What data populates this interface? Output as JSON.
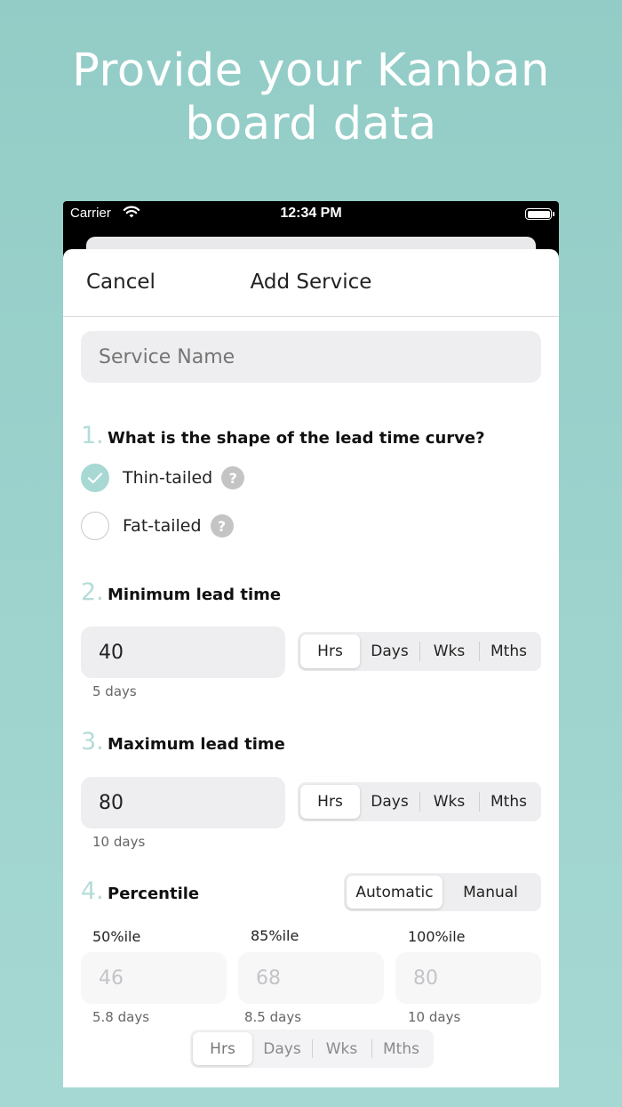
{
  "headline": {
    "line1": "Provide your Kanban",
    "line2": "board data"
  },
  "status_bar": {
    "carrier": "Carrier",
    "time": "12:34 PM"
  },
  "nav": {
    "cancel_label": "Cancel",
    "title": "Add Service"
  },
  "service_name": {
    "placeholder": "Service Name",
    "value": ""
  },
  "section1": {
    "number": "1.",
    "title": "What is the shape of the lead time curve?",
    "options": [
      {
        "label": "Thin-tailed",
        "checked": true
      },
      {
        "label": "Fat-tailed",
        "checked": false
      }
    ],
    "help_glyph": "?"
  },
  "section2": {
    "number": "2.",
    "title": "Minimum lead time",
    "value": "40",
    "caption": "5 days",
    "units": [
      "Hrs",
      "Days",
      "Wks",
      "Mths"
    ],
    "selected_unit": "Hrs"
  },
  "section3": {
    "number": "3.",
    "title": "Maximum lead time",
    "value": "80",
    "caption": "10 days",
    "units": [
      "Hrs",
      "Days",
      "Wks",
      "Mths"
    ],
    "selected_unit": "Hrs"
  },
  "section4": {
    "number": "4.",
    "title": "Percentile",
    "modes": [
      "Automatic",
      "Manual"
    ],
    "selected_mode": "Automatic",
    "percentiles": [
      {
        "label": "50%ile",
        "value": "46",
        "caption": "5.8 days"
      },
      {
        "label": "85%ile",
        "value": "68",
        "caption": "8.5 days"
      },
      {
        "label": "100%ile",
        "value": "80",
        "caption": "10 days"
      }
    ],
    "units": [
      "Hrs",
      "Days",
      "Wks",
      "Mths"
    ],
    "selected_unit": "Hrs"
  },
  "colors": {
    "background": "#93ccc6",
    "accent": "#a8d8d3",
    "section_number": "#b5dcd8"
  }
}
